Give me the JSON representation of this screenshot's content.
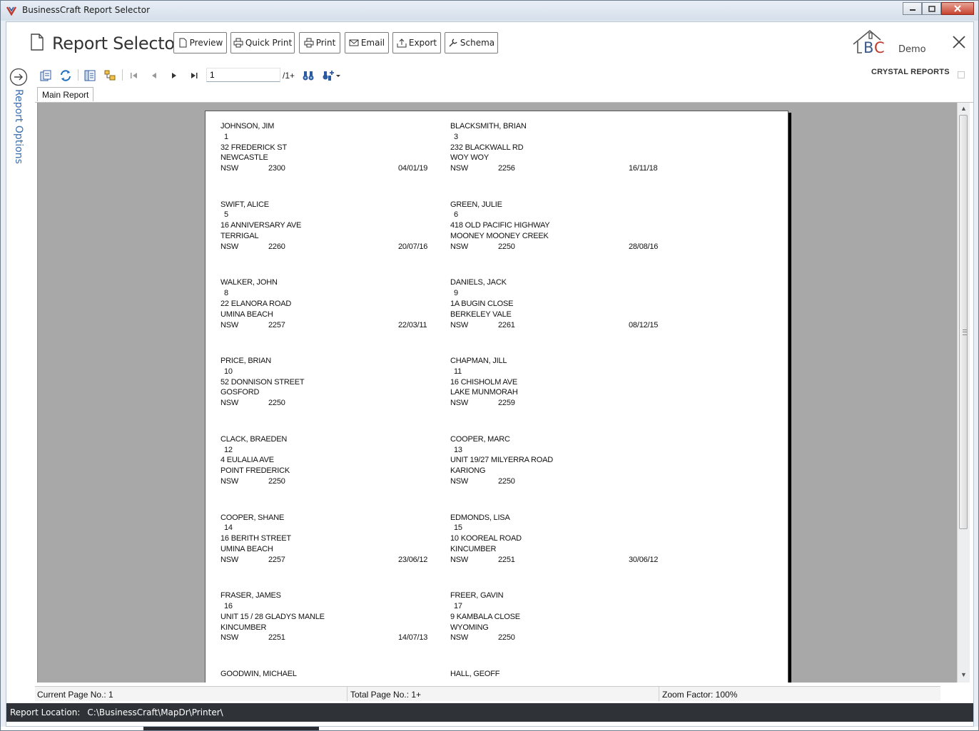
{
  "window": {
    "title": "BusinessCraft Report Selector"
  },
  "header": {
    "title": "Report Selector",
    "buttons": {
      "preview": "Preview",
      "quick_print": "Quick Print",
      "print": "Print",
      "email": "Email",
      "export": "Export",
      "schema": "Schema"
    },
    "logo_demo": "Demo"
  },
  "sidebar": {
    "report_options": "Report Options"
  },
  "viewer": {
    "page_input": "1",
    "page_of": "/1+",
    "brand": "CRYSTAL REPORTS",
    "tab": "Main Report"
  },
  "records": [
    {
      "name": "JOHNSON, JIM",
      "num": "1",
      "addr": "32 FREDERICK ST",
      "suburb": "NEWCASTLE",
      "state": "NSW",
      "pc": "2300",
      "date": "04/01/19"
    },
    {
      "name": "BLACKSMITH, BRIAN",
      "num": "3",
      "addr": "232 BLACKWALL RD",
      "suburb": "WOY WOY",
      "state": "NSW",
      "pc": "2256",
      "date": "16/11/18"
    },
    {
      "name": "SWIFT, ALICE",
      "num": "5",
      "addr": "16 ANNIVERSARY AVE",
      "suburb": "TERRIGAL",
      "state": "NSW",
      "pc": "2260",
      "date": "20/07/16"
    },
    {
      "name": "GREEN, JULIE",
      "num": "6",
      "addr": "418 OLD PACIFIC HIGHWAY",
      "suburb": "MOONEY MOONEY CREEK",
      "state": "NSW",
      "pc": "2250",
      "date": "28/08/16"
    },
    {
      "name": "WALKER, JOHN",
      "num": "8",
      "addr": "22 ELANORA ROAD",
      "suburb": "UMINA BEACH",
      "state": "NSW",
      "pc": "2257",
      "date": "22/03/11"
    },
    {
      "name": "DANIELS, JACK",
      "num": "9",
      "addr": "1A BUGIN CLOSE",
      "suburb": "BERKELEY VALE",
      "state": "NSW",
      "pc": "2261",
      "date": "08/12/15"
    },
    {
      "name": "PRICE, BRIAN",
      "num": "10",
      "addr": "52 DONNISON STREET",
      "suburb": "GOSFORD",
      "state": "NSW",
      "pc": "2250",
      "date": ""
    },
    {
      "name": "CHAPMAN, JILL",
      "num": "11",
      "addr": "16 CHISHOLM AVE",
      "suburb": "LAKE MUNMORAH",
      "state": "NSW",
      "pc": "2259",
      "date": ""
    },
    {
      "name": "CLACK, BRAEDEN",
      "num": "12",
      "addr": "4 EULALIA AVE",
      "suburb": "POINT FREDERICK",
      "state": "NSW",
      "pc": "2250",
      "date": ""
    },
    {
      "name": "COOPER, MARC",
      "num": "13",
      "addr": "UNIT 19/27 MILYERRA ROAD",
      "suburb": "KARIONG",
      "state": "NSW",
      "pc": "2250",
      "date": ""
    },
    {
      "name": "COOPER, SHANE",
      "num": "14",
      "addr": "16 BERITH STREET",
      "suburb": "UMINA BEACH",
      "state": "NSW",
      "pc": "2257",
      "date": "23/06/12"
    },
    {
      "name": "EDMONDS, LISA",
      "num": "15",
      "addr": "10 KOOREAL ROAD",
      "suburb": "KINCUMBER",
      "state": "NSW",
      "pc": "2251",
      "date": "30/06/12"
    },
    {
      "name": "FRASER, JAMES",
      "num": "16",
      "addr": "UNIT 15 / 28 GLADYS MANLE",
      "suburb": "KINCUMBER",
      "state": "NSW",
      "pc": "2251",
      "date": "14/07/13"
    },
    {
      "name": "FREER, GAVIN",
      "num": "17",
      "addr": "9 KAMBALA CLOSE",
      "suburb": "WYOMING",
      "state": "NSW",
      "pc": "2250",
      "date": ""
    },
    {
      "name": "GOODWIN, MICHAEL",
      "num": "",
      "addr": "",
      "suburb": "",
      "state": "",
      "pc": "",
      "date": ""
    },
    {
      "name": "HALL, GEOFF",
      "num": "",
      "addr": "",
      "suburb": "",
      "state": "",
      "pc": "",
      "date": ""
    }
  ],
  "status": {
    "current_page": "Current Page No.: 1",
    "total_page": "Total Page No.: 1+",
    "zoom": "Zoom Factor: 100%"
  },
  "footer": {
    "label": "Report Location:",
    "value": "C:\\BusinessCraft\\MapDr\\Printer\\"
  },
  "colors": {
    "accent": "#3d6fae",
    "footer_bg": "#2f3338",
    "report_bg": "#a8a8a8"
  }
}
